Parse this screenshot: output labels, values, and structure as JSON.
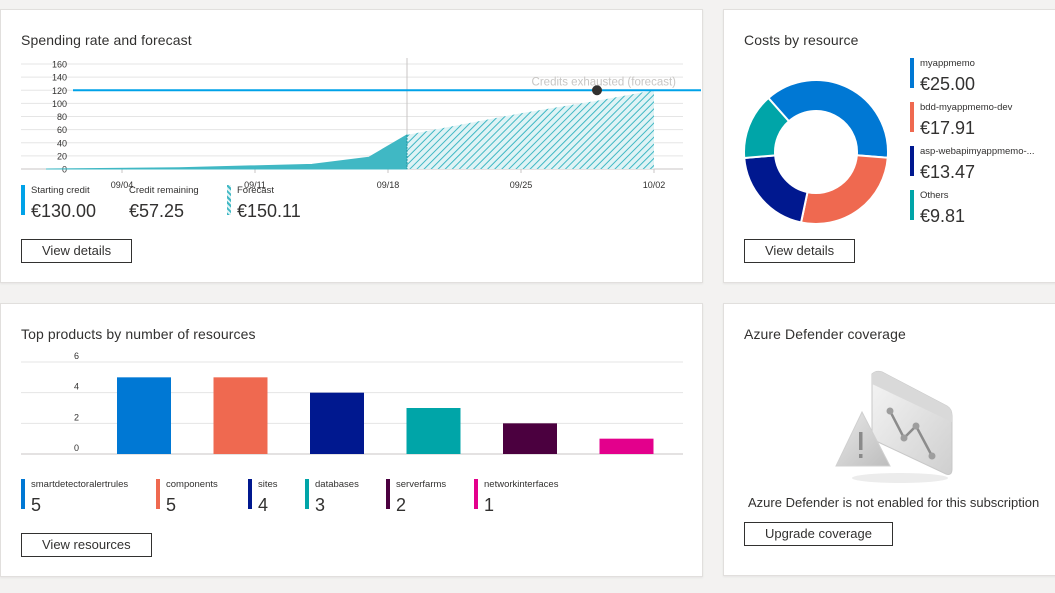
{
  "spending": {
    "title": "Spending rate and forecast",
    "annotation": "Credits exhausted (forecast)",
    "button": "View details",
    "legend": [
      {
        "label": "Starting credit",
        "value": "€130.00",
        "color": "#00a2e8",
        "style": "solid"
      },
      {
        "label": "Credit remaining",
        "value": "€57.25",
        "color": "",
        "style": "none"
      },
      {
        "label": "Forecast",
        "value": "€150.11",
        "color": "#40b8c4",
        "style": "hatched"
      }
    ]
  },
  "costs": {
    "title": "Costs by resource",
    "button": "View details",
    "legend": [
      {
        "label": "myappmemo",
        "value": "€25.00",
        "color": "#0078d4"
      },
      {
        "label": "bdd-myappmemo-dev",
        "value": "€17.91",
        "color": "#ef6950"
      },
      {
        "label": "asp-webapimyappmemo-...",
        "value": "€13.47",
        "color": "#00188f"
      },
      {
        "label": "Others",
        "value": "€9.81",
        "color": "#00a5a8"
      }
    ]
  },
  "products": {
    "title": "Top products by number of resources",
    "button": "View resources",
    "legend": [
      {
        "label": "smartdetectoralertrules",
        "value": "5"
      },
      {
        "label": "components",
        "value": "5"
      },
      {
        "label": "sites",
        "value": "4"
      },
      {
        "label": "databases",
        "value": "3"
      },
      {
        "label": "serverfarms",
        "value": "2"
      },
      {
        "label": "networkinterfaces",
        "value": "1"
      }
    ]
  },
  "defender": {
    "title": "Azure Defender coverage",
    "message": "Azure Defender is not enabled for this subscription",
    "button": "Upgrade coverage"
  },
  "chart_data": [
    {
      "type": "area",
      "title": "Spending rate and forecast",
      "x_tick_labels": [
        "09/04",
        "09/11",
        "09/18",
        "09/25",
        "10/02"
      ],
      "y_tick_labels": [
        "0",
        "20",
        "40",
        "60",
        "80",
        "100",
        "120",
        "140",
        "160"
      ],
      "ylim": [
        0,
        160
      ],
      "grid": true,
      "reference_line": {
        "value": 120,
        "color": "#00a2e8"
      },
      "series": [
        {
          "name": "Credit remaining",
          "color": "#40b8c4",
          "style": "solid",
          "points": [
            [
              "08/31",
              0
            ],
            [
              "09/07",
              2
            ],
            [
              "09/14",
              7
            ],
            [
              "09/17",
              18
            ],
            [
              "09/19",
              52
            ]
          ]
        },
        {
          "name": "Forecast",
          "color": "#40b8c4",
          "style": "hatched",
          "points": [
            [
              "09/19",
              52
            ],
            [
              "09/25",
              85
            ],
            [
              "09/29",
              104
            ],
            [
              "10/02",
              120
            ]
          ]
        }
      ],
      "marker": {
        "x": "09/29",
        "y": 120,
        "label": "Credits exhausted (forecast)"
      }
    },
    {
      "type": "pie",
      "title": "Costs by resource",
      "donut": true,
      "categories": [
        "myappmemo",
        "bdd-myappmemo-dev",
        "asp-webapimyappmemo-...",
        "Others"
      ],
      "values": [
        25.0,
        17.91,
        13.47,
        9.81
      ],
      "colors": [
        "#0078d4",
        "#ef6950",
        "#00188f",
        "#00a5a8"
      ],
      "legend_position": "right"
    },
    {
      "type": "bar",
      "title": "Top products by number of resources",
      "categories": [
        "smartdetectoralertrules",
        "components",
        "sites",
        "databases",
        "serverfarms",
        "networkinterfaces"
      ],
      "values": [
        5,
        5,
        4,
        3,
        2,
        1
      ],
      "colors": [
        "#0078d4",
        "#ef6950",
        "#00188f",
        "#00a5a8",
        "#4b003f",
        "#e3008c"
      ],
      "y_tick_labels": [
        "0",
        "2",
        "4",
        "6"
      ],
      "ylim": [
        0,
        6
      ],
      "grid": true,
      "legend_position": "bottom"
    }
  ]
}
